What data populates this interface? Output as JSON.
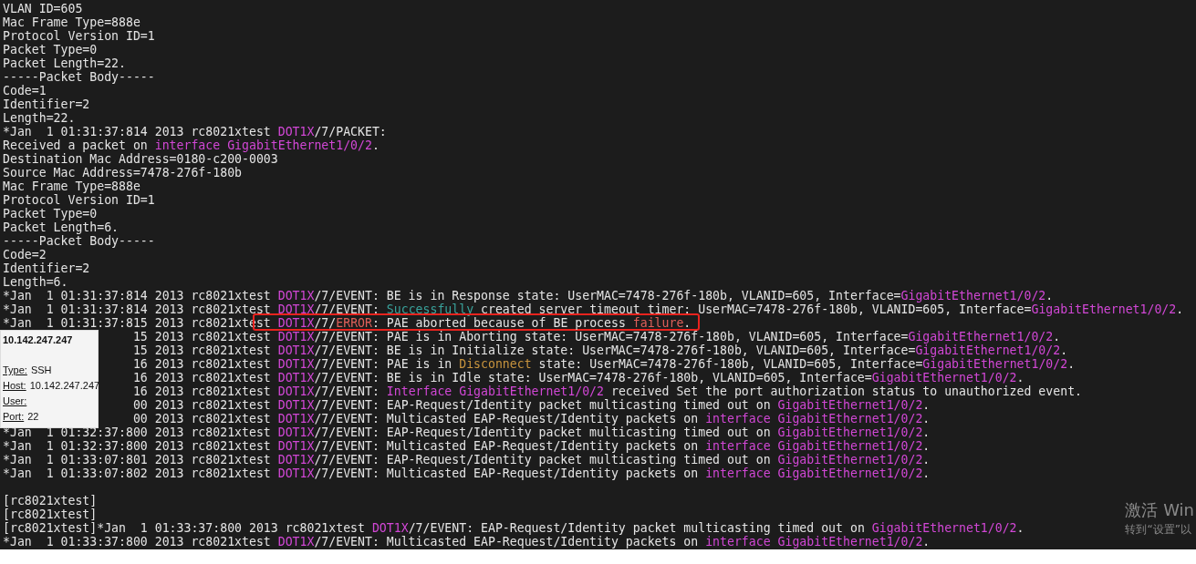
{
  "terminal": {
    "lines": [
      {
        "kind": "text",
        "segments": [
          {
            "text": "VLAN ID=605"
          }
        ]
      },
      {
        "kind": "text",
        "segments": [
          {
            "text": "Mac Frame Type=888e"
          }
        ]
      },
      {
        "kind": "text",
        "segments": [
          {
            "text": "Protocol Version ID=1"
          }
        ]
      },
      {
        "kind": "text",
        "segments": [
          {
            "text": "Packet Type=0"
          }
        ]
      },
      {
        "kind": "text",
        "segments": [
          {
            "text": "Packet Length=22."
          }
        ]
      },
      {
        "kind": "text",
        "segments": [
          {
            "text": "-----Packet Body-----"
          }
        ]
      },
      {
        "kind": "text",
        "segments": [
          {
            "text": "Code=1"
          }
        ]
      },
      {
        "kind": "text",
        "segments": [
          {
            "text": "Identifier=2"
          }
        ]
      },
      {
        "kind": "text",
        "segments": [
          {
            "text": "Length=22."
          }
        ]
      },
      {
        "kind": "text",
        "segments": [
          {
            "text": "*Jan  1 01:31:37:814 2013 rc8021xtest "
          },
          {
            "text": "DOT1X",
            "color": "#d247d6"
          },
          {
            "text": "/7/PACKET:"
          }
        ]
      },
      {
        "kind": "text",
        "segments": [
          {
            "text": "Received a packet on "
          },
          {
            "text": "interface GigabitEthernet1/0/2",
            "color": "#d247d6"
          },
          {
            "text": "."
          }
        ]
      },
      {
        "kind": "text",
        "segments": [
          {
            "text": "Destination Mac Address=0180-c200-0003"
          }
        ]
      },
      {
        "kind": "text",
        "segments": [
          {
            "text": "Source Mac Address=7478-276f-180b"
          }
        ]
      },
      {
        "kind": "text",
        "segments": [
          {
            "text": "Mac Frame Type=888e"
          }
        ]
      },
      {
        "kind": "text",
        "segments": [
          {
            "text": "Protocol Version ID=1"
          }
        ]
      },
      {
        "kind": "text",
        "segments": [
          {
            "text": "Packet Type=0"
          }
        ]
      },
      {
        "kind": "text",
        "segments": [
          {
            "text": "Packet Length=6."
          }
        ]
      },
      {
        "kind": "text",
        "segments": [
          {
            "text": "-----Packet Body-----"
          }
        ]
      },
      {
        "kind": "text",
        "segments": [
          {
            "text": "Code=2"
          }
        ]
      },
      {
        "kind": "text",
        "segments": [
          {
            "text": "Identifier=2"
          }
        ]
      },
      {
        "kind": "text",
        "segments": [
          {
            "text": "Length=6."
          }
        ]
      },
      {
        "kind": "text",
        "segments": [
          {
            "text": "*Jan  1 01:31:37:814 2013 rc8021xtest "
          },
          {
            "text": "DOT1X",
            "color": "#d247d6"
          },
          {
            "text": "/7/EVENT: BE is in Response state: UserMAC=7478-276f-180b, VLANID=605, Interface="
          },
          {
            "text": "GigabitEthernet1/0/2",
            "color": "#d247d6"
          },
          {
            "text": "."
          }
        ]
      },
      {
        "kind": "text",
        "segments": [
          {
            "text": "*Jan  1 01:31:37:814 2013 rc8021xtest "
          },
          {
            "text": "DOT1X",
            "color": "#d247d6"
          },
          {
            "text": "/7/EVENT: "
          },
          {
            "text": "Successfully",
            "color": "#3aa39c"
          },
          {
            "text": " created server timeout timer: UserMAC=7478-276f-180b, VLANID=605, Interface="
          },
          {
            "text": "GigabitEthernet1/0/2",
            "color": "#d247d6"
          },
          {
            "text": "."
          }
        ]
      },
      {
        "kind": "highlighted",
        "segments": [
          {
            "text": "*Jan  1 01:31:37:815 2013 rc8021xte"
          }
        ],
        "highlight": [
          {
            "text": "st "
          },
          {
            "text": "DOT1X",
            "color": "#d247d6"
          },
          {
            "text": "/7/"
          },
          {
            "text": "ERROR",
            "color": "#e0605a"
          },
          {
            "text": ": PAE aborted because of BE process "
          },
          {
            "text": "failure",
            "color": "#e0605a"
          },
          {
            "text": "."
          }
        ]
      },
      {
        "kind": "covered",
        "segments": [
          {
            "text": "15 2013 rc8021xtest "
          },
          {
            "text": "DOT1X",
            "color": "#d247d6"
          },
          {
            "text": "/7/EVENT: PAE is in Aborting state: UserMAC=7478-276f-180b, VLANID=605, Interface="
          },
          {
            "text": "GigabitEthernet1/0/2",
            "color": "#d247d6"
          },
          {
            "text": "."
          }
        ]
      },
      {
        "kind": "covered",
        "segments": [
          {
            "text": "15 2013 rc8021xtest "
          },
          {
            "text": "DOT1X",
            "color": "#d247d6"
          },
          {
            "text": "/7/EVENT: BE is in Initialize state: UserMAC=7478-276f-180b, VLANID=605, Interface="
          },
          {
            "text": "GigabitEthernet1/0/2",
            "color": "#d247d6"
          },
          {
            "text": "."
          }
        ]
      },
      {
        "kind": "covered",
        "segments": [
          {
            "text": "16 2013 rc8021xtest "
          },
          {
            "text": "DOT1X",
            "color": "#d247d6"
          },
          {
            "text": "/7/EVENT: PAE is in "
          },
          {
            "text": "Disconnect",
            "color": "#c8943e"
          },
          {
            "text": " state: UserMAC=7478-276f-180b, VLANID=605, Interface="
          },
          {
            "text": "GigabitEthernet1/0/2",
            "color": "#d247d6"
          },
          {
            "text": "."
          }
        ]
      },
      {
        "kind": "covered",
        "segments": [
          {
            "text": "16 2013 rc8021xtest "
          },
          {
            "text": "DOT1X",
            "color": "#d247d6"
          },
          {
            "text": "/7/EVENT: BE is in Idle state: UserMAC=7478-276f-180b, VLANID=605, Interface="
          },
          {
            "text": "GigabitEthernet1/0/2",
            "color": "#d247d6"
          },
          {
            "text": "."
          }
        ]
      },
      {
        "kind": "covered",
        "segments": [
          {
            "text": "16 2013 rc8021xtest "
          },
          {
            "text": "DOT1X",
            "color": "#d247d6"
          },
          {
            "text": "/7/EVENT: "
          },
          {
            "text": "Interface GigabitEthernet1/0/2",
            "color": "#d247d6"
          },
          {
            "text": " received Set the port authorization status to unauthorized event."
          }
        ]
      },
      {
        "kind": "covered",
        "segments": [
          {
            "text": "00 2013 rc8021xtest "
          },
          {
            "text": "DOT1X",
            "color": "#d247d6"
          },
          {
            "text": "/7/EVENT: EAP-Request/Identity packet multicasting timed out on "
          },
          {
            "text": "GigabitEthernet1/0/2",
            "color": "#d247d6"
          },
          {
            "text": "."
          }
        ]
      },
      {
        "kind": "covered",
        "segments": [
          {
            "text": "00 2013 rc8021xtest "
          },
          {
            "text": "DOT1X",
            "color": "#d247d6"
          },
          {
            "text": "/7/EVENT: Multicasted EAP-Request/Identity packets on "
          },
          {
            "text": "interface GigabitEthernet1/0/2",
            "color": "#d247d6"
          },
          {
            "text": "."
          }
        ]
      },
      {
        "kind": "text",
        "segments": [
          {
            "text": "*Jan  1 01:32:37:800 2013 rc8021xtest "
          },
          {
            "text": "DOT1X",
            "color": "#d247d6"
          },
          {
            "text": "/7/EVENT: EAP-Request/Identity packet multicasting timed out on "
          },
          {
            "text": "GigabitEthernet1/0/2",
            "color": "#d247d6"
          },
          {
            "text": "."
          }
        ]
      },
      {
        "kind": "text",
        "segments": [
          {
            "text": "*Jan  1 01:32:37:800 2013 rc8021xtest "
          },
          {
            "text": "DOT1X",
            "color": "#d247d6"
          },
          {
            "text": "/7/EVENT: Multicasted EAP-Request/Identity packets on "
          },
          {
            "text": "interface GigabitEthernet1/0/2",
            "color": "#d247d6"
          },
          {
            "text": "."
          }
        ]
      },
      {
        "kind": "text",
        "segments": [
          {
            "text": "*Jan  1 01:33:07:801 2013 rc8021xtest "
          },
          {
            "text": "DOT1X",
            "color": "#d247d6"
          },
          {
            "text": "/7/EVENT: EAP-Request/Identity packet multicasting timed out on "
          },
          {
            "text": "GigabitEthernet1/0/2",
            "color": "#d247d6"
          },
          {
            "text": "."
          }
        ]
      },
      {
        "kind": "text",
        "segments": [
          {
            "text": "*Jan  1 01:33:07:802 2013 rc8021xtest "
          },
          {
            "text": "DOT1X",
            "color": "#d247d6"
          },
          {
            "text": "/7/EVENT: Multicasted EAP-Request/Identity packets on "
          },
          {
            "text": "interface GigabitEthernet1/0/2",
            "color": "#d247d6"
          },
          {
            "text": "."
          }
        ]
      },
      {
        "kind": "blank"
      },
      {
        "kind": "text",
        "segments": [
          {
            "text": "[rc8021xtest]"
          }
        ]
      },
      {
        "kind": "text",
        "segments": [
          {
            "text": "[rc8021xtest]"
          }
        ]
      },
      {
        "kind": "text",
        "segments": [
          {
            "text": "[rc8021xtest]*Jan  1 01:33:37:800 2013 rc8021xtest "
          },
          {
            "text": "DOT1X",
            "color": "#d247d6"
          },
          {
            "text": "/7/EVENT: EAP-Request/Identity packet multicasting timed out on "
          },
          {
            "text": "GigabitEthernet1/0/2",
            "color": "#d247d6"
          },
          {
            "text": "."
          }
        ]
      },
      {
        "kind": "text",
        "segments": [
          {
            "text": "*Jan  1 01:33:37:800 2013 rc8021xtest "
          },
          {
            "text": "DOT1X",
            "color": "#d247d6"
          },
          {
            "text": "/7/EVENT: Multicasted EAP-Request/Identity packets on "
          },
          {
            "text": "interface GigabitEthernet1/0/2",
            "color": "#d247d6"
          },
          {
            "text": "."
          }
        ]
      }
    ]
  },
  "tooltip": {
    "title": "10.142.247.247",
    "fields": [
      {
        "label": "Type:",
        "value": "SSH"
      },
      {
        "label": "Host:",
        "value": "10.142.247.247"
      },
      {
        "label": "User:"
      },
      {
        "label": "Port:",
        "value": "22"
      }
    ]
  },
  "activation_notice": {
    "title": "激活 Win",
    "subtitle": "转到“设置”以"
  }
}
